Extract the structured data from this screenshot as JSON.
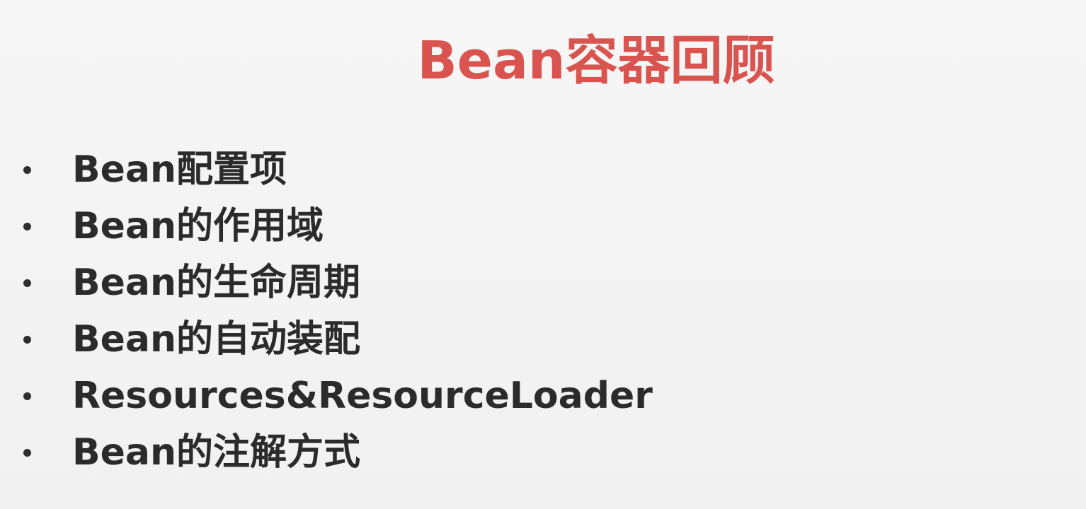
{
  "slide": {
    "title": "Bean容器回顾",
    "title_color": "#d9534f",
    "bullets": [
      {
        "text": "Bean配置项"
      },
      {
        "text": "Bean的作用域"
      },
      {
        "text": "Bean的生命周期"
      },
      {
        "text": "Bean的自动装配"
      },
      {
        "text": "Resources&ResourceLoader"
      },
      {
        "text": "Bean的注解方式"
      }
    ]
  }
}
